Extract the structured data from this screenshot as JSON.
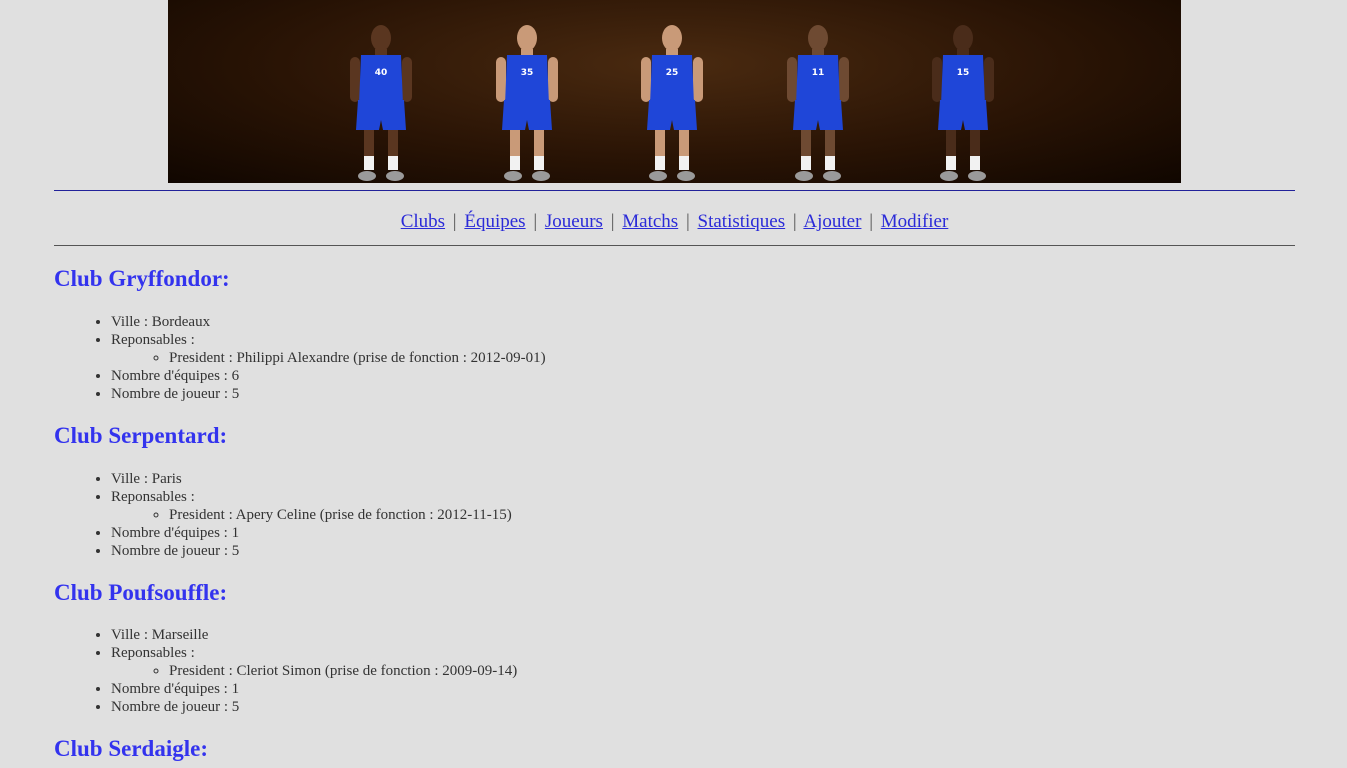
{
  "nav": {
    "items": [
      "Clubs",
      "Équipes",
      "Joueurs",
      "Matchs",
      "Statistiques",
      "Ajouter",
      "Modifier"
    ],
    "separator": "|"
  },
  "banner": {
    "jersey_numbers": [
      "40",
      "35",
      "25",
      "11",
      "15"
    ],
    "jersey_color": "#1f46d8"
  },
  "clubs": [
    {
      "title": "Club Gryffondor:",
      "ville": "Ville : Bordeaux",
      "responsables": "Reponsables :",
      "president": "President : Philippi Alexandre (prise de fonction : 2012-09-01)",
      "equipes": "Nombre d'équipes : 6",
      "joueurs": "Nombre de joueur : 5"
    },
    {
      "title": "Club Serpentard:",
      "ville": "Ville : Paris",
      "responsables": "Reponsables :",
      "president": "President : Apery Celine (prise de fonction : 2012-11-15)",
      "equipes": "Nombre d'équipes : 1",
      "joueurs": "Nombre de joueur : 5"
    },
    {
      "title": "Club Poufsouffle:",
      "ville": "Ville : Marseille",
      "responsables": "Reponsables :",
      "president": "President : Cleriot Simon (prise de fonction : 2009-09-14)",
      "equipes": "Nombre d'équipes : 1",
      "joueurs": "Nombre de joueur : 5"
    },
    {
      "title": "Club Serdaigle:"
    }
  ],
  "colors": {
    "background": "#e0e0e0",
    "heading": "#3333ee",
    "link": "#2b2bd8"
  }
}
